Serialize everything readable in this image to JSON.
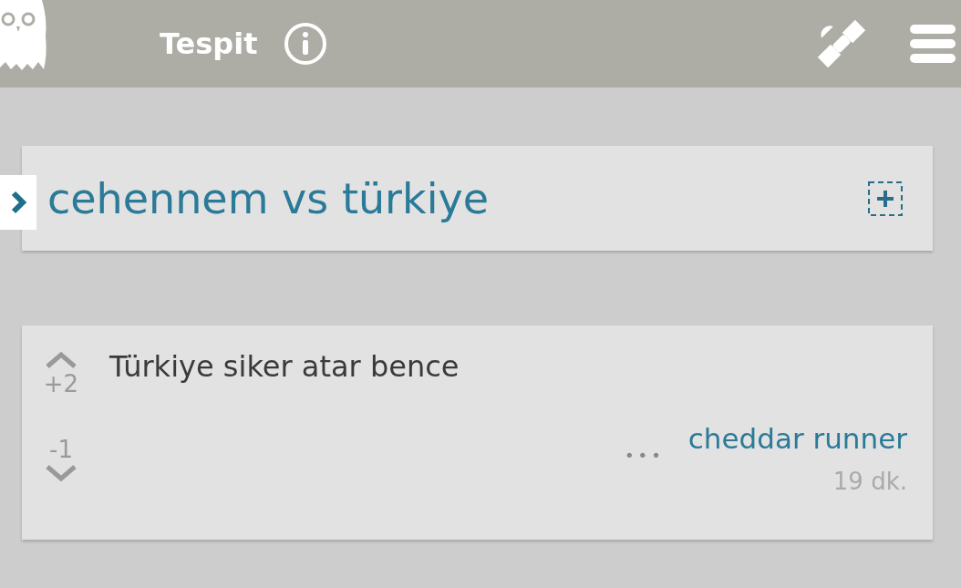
{
  "header": {
    "title": "Tespit"
  },
  "topic": {
    "title": "cehennem vs türkiye"
  },
  "entries": [
    {
      "text": "Türkiye siker atar bence",
      "upvotes": "+2",
      "downvotes": "-1",
      "more": "•••",
      "author": "cheddar runner",
      "time": "19 dk."
    }
  ]
}
